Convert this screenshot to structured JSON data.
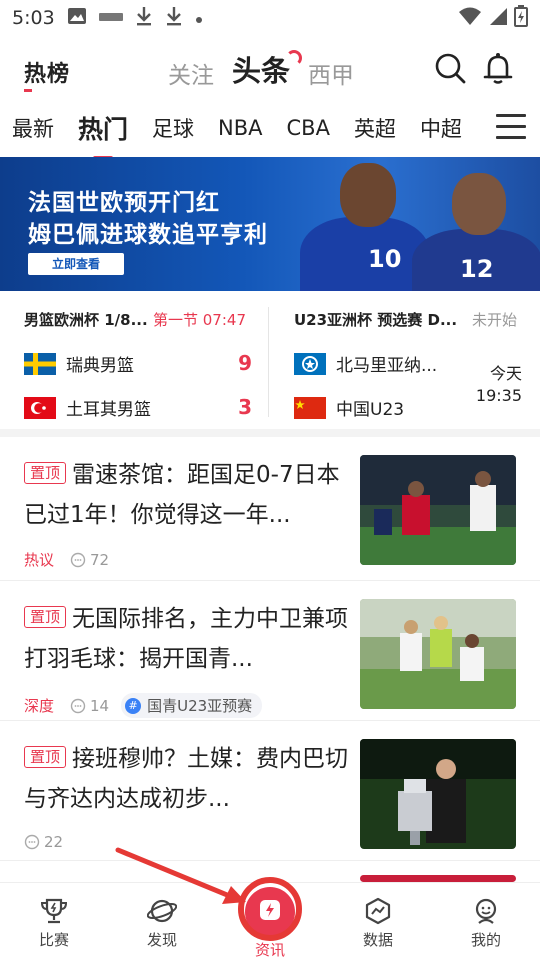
{
  "status_bar": {
    "time": "5:03",
    "icons": [
      "image-icon",
      "app-icon",
      "download-icon",
      "download-icon",
      "dot-icon"
    ],
    "right_icons": [
      "wifi-icon",
      "signal-icon",
      "battery-icon"
    ]
  },
  "header": {
    "logo": "热榜",
    "tabs": [
      {
        "label": "关注",
        "active": false
      },
      {
        "label": "头条",
        "active": true
      },
      {
        "label": "西甲",
        "active": false
      }
    ],
    "search_icon": "search-icon",
    "bell_icon": "bell-icon"
  },
  "categories": {
    "items": [
      {
        "label": "最新",
        "active": false
      },
      {
        "label": "热门",
        "active": true
      },
      {
        "label": "足球",
        "active": false
      },
      {
        "label": "NBA",
        "active": false
      },
      {
        "label": "CBA",
        "active": false
      },
      {
        "label": "英超",
        "active": false
      },
      {
        "label": "中超",
        "active": false
      }
    ],
    "menu_icon": "menu-icon"
  },
  "banner": {
    "line1": "法国世欧预开门红",
    "line2": "姆巴佩进球数追平亨利",
    "cta": "立即查看",
    "shirt_numbers": [
      "10",
      "12"
    ]
  },
  "matches": [
    {
      "title": "男篮欧洲杯 1/8...",
      "status": "第一节 07:47",
      "team1": {
        "name": "瑞典男篮",
        "score": "9"
      },
      "team2": {
        "name": "土耳其男篮",
        "score": "3"
      }
    },
    {
      "title": "U23亚洲杯 预选赛 D...",
      "status": "未开始",
      "team1": {
        "name": "北马里亚纳..."
      },
      "team2": {
        "name": "中国U23"
      },
      "date": "今天",
      "time": "19:35"
    }
  ],
  "news": [
    {
      "pin": "置顶",
      "title": "雷速茶馆：距国足0-7日本已过1年！你觉得这一年...",
      "tag": "热议",
      "comments": "72"
    },
    {
      "pin": "置顶",
      "title": "无国际排名，主力中卫兼项打羽毛球：揭开国青...",
      "tag": "深度",
      "comments": "14",
      "topic": "国青U23亚预赛"
    },
    {
      "pin": "置顶",
      "title": "接班穆帅？土媒：费内巴切与齐达内达成初步...",
      "comments": "22"
    }
  ],
  "tabbar": {
    "items": [
      {
        "label": "比赛",
        "icon": "trophy-icon",
        "active": false
      },
      {
        "label": "发现",
        "icon": "planet-icon",
        "active": false
      },
      {
        "label": "资讯",
        "icon": "lightning-icon",
        "active": true
      },
      {
        "label": "数据",
        "icon": "chart-icon",
        "active": false
      },
      {
        "label": "我的",
        "icon": "profile-icon",
        "active": false
      }
    ]
  },
  "colors": {
    "accent": "#e8384f",
    "banner_blue": "#1357b8",
    "arrow": "#e53935"
  }
}
